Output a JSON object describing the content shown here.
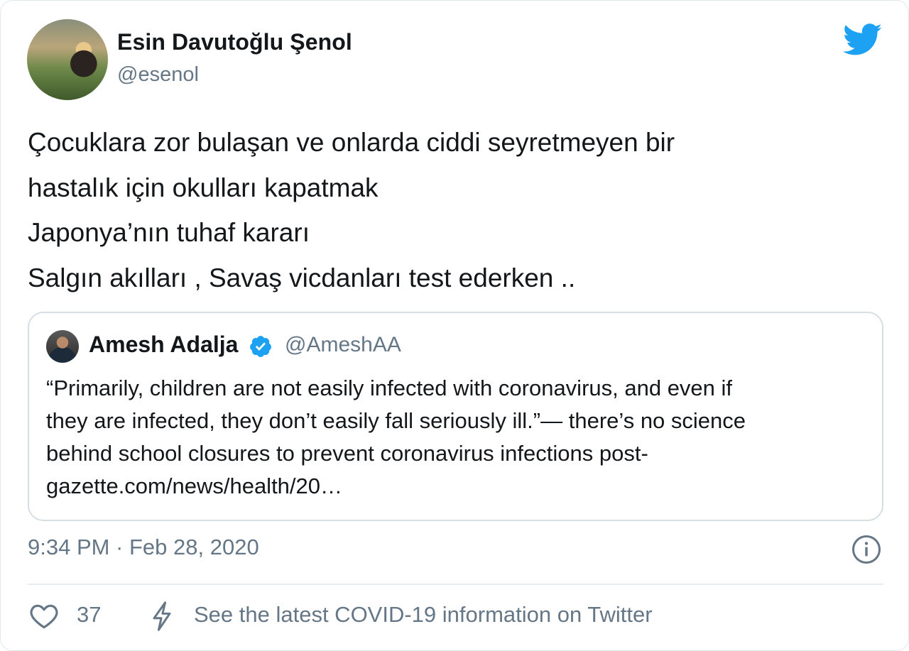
{
  "author": {
    "name": "Esin Davutoğlu Şenol",
    "handle": "@esenol"
  },
  "tweet": {
    "lines": [
      "Çocuklara zor bulaşan ve onlarda ciddi seyretmeyen bir",
      "hastalık için okulları kapatmak",
      "Japonya’nın tuhaf kararı",
      "Salgın akılları , Savaş vicdanları test ederken .."
    ]
  },
  "quoted": {
    "name": "Amesh Adalja",
    "handle": "@AmeshAA",
    "verified": true,
    "lines": [
      "“Primarily, children are not easily infected with coronavirus, and even if",
      "they are infected, they don’t easily fall seriously ill.”— there’s no science",
      "behind school closures to prevent coronavirus infections  post-",
      "gazette.com/news/health/20…"
    ]
  },
  "timestamp": "9:34 PM · Feb 28, 2020",
  "actions": {
    "like_count": "37",
    "covid_link": "See the latest COVID-19 information on Twitter"
  },
  "icons": {
    "brand": "twitter-bird-icon",
    "verified": "verified-badge-icon",
    "info": "info-icon",
    "like": "heart-icon",
    "covid": "lightning-bolt-icon"
  },
  "colors": {
    "twitter_blue": "#1da1f2",
    "secondary_text": "#657786",
    "border": "#e1e8ed"
  }
}
